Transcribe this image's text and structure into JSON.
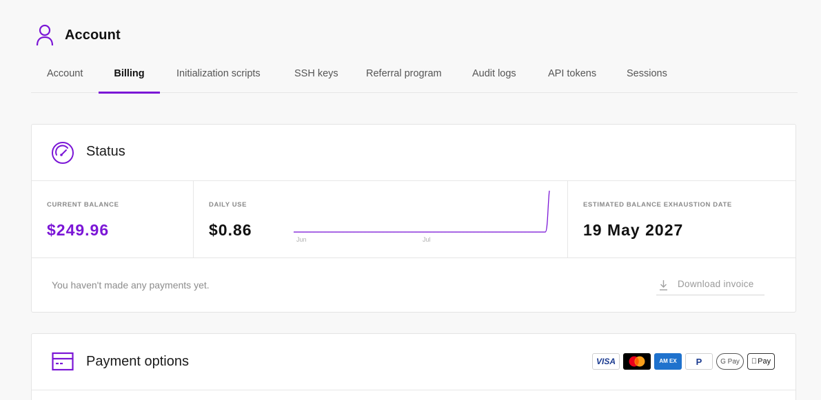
{
  "header": {
    "title": "Account",
    "icon": "user-icon"
  },
  "tabs": [
    {
      "label": "Account"
    },
    {
      "label": "Billing"
    },
    {
      "label": "Initialization scripts"
    },
    {
      "label": "SSH keys"
    },
    {
      "label": "Referral program"
    },
    {
      "label": "Audit logs"
    },
    {
      "label": "API tokens"
    },
    {
      "label": "Sessions"
    }
  ],
  "active_tab": "Billing",
  "status": {
    "title": "Status",
    "icon": "speedometer-icon",
    "current_balance": {
      "label": "CURRENT BALANCE",
      "value": "$249.96"
    },
    "daily_use": {
      "label": "DAILY USE",
      "value": "$0.86",
      "sparkline_ticks": [
        "Jun",
        "Jul"
      ]
    },
    "exhaustion": {
      "label": "ESTIMATED BALANCE EXHAUSTION DATE",
      "value": "19 May 2027"
    },
    "payments_message": "You haven't made any payments yet.",
    "download_invoice_label": "Download invoice"
  },
  "payment_options": {
    "title": "Payment options",
    "icon": "credit-card-icon",
    "methods": [
      {
        "name": "visa-logo",
        "text": "VISA"
      },
      {
        "name": "mastercard-logo",
        "text": ""
      },
      {
        "name": "amex-logo",
        "text": "AM EX"
      },
      {
        "name": "paypal-logo",
        "text": "P"
      },
      {
        "name": "google-pay-logo",
        "text": "G Pay"
      },
      {
        "name": "apple-pay-logo",
        "text": "Pay"
      }
    ]
  },
  "colors": {
    "accent": "#7b16d6",
    "border": "#e6e6e6",
    "muted": "#8a8a8a"
  }
}
